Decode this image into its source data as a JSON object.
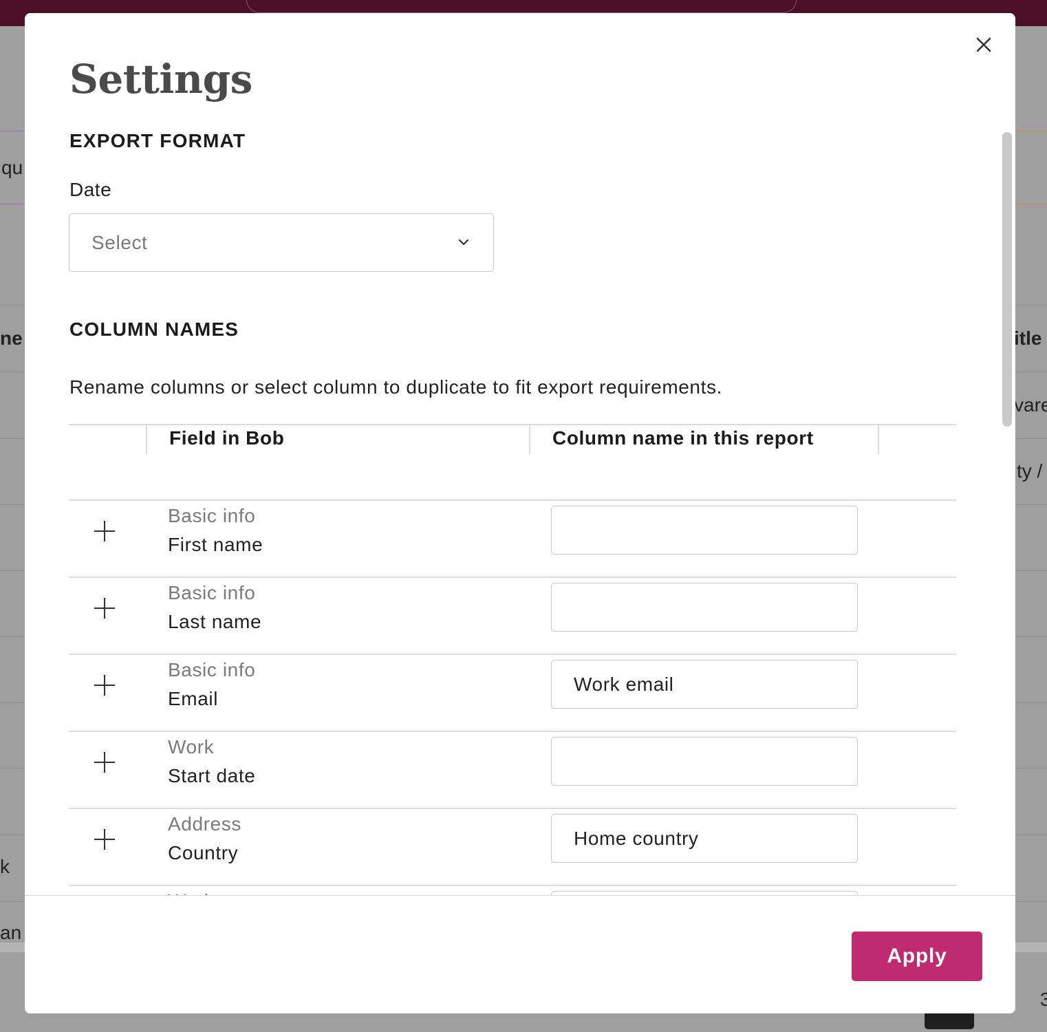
{
  "background": {
    "fragments": [
      "qu",
      "ne",
      "itle",
      "vare",
      "ty /",
      "k",
      "an",
      "3"
    ]
  },
  "modal": {
    "title": "Settings",
    "close_icon": "close-icon",
    "export_format": {
      "heading": "EXPORT FORMAT",
      "date_label": "Date",
      "date_select": {
        "value": "Select",
        "icon": "chevron-down-icon"
      }
    },
    "column_names": {
      "heading": "COLUMN NAMES",
      "description": "Rename columns or select column to duplicate to fit export requirements.",
      "table": {
        "headers": [
          "Field in Bob",
          "Column name in this report"
        ],
        "rows": [
          {
            "category": "Basic info",
            "field": "First name",
            "column_name": ""
          },
          {
            "category": "Basic info",
            "field": "Last name",
            "column_name": ""
          },
          {
            "category": "Basic info",
            "field": "Email",
            "column_name": "Work email"
          },
          {
            "category": "Work",
            "field": "Start date",
            "column_name": ""
          },
          {
            "category": "Address",
            "field": "Country",
            "column_name": "Home country"
          },
          {
            "category": "Work",
            "field": "",
            "column_name": ""
          }
        ],
        "row_action_icon": "plus-icon"
      }
    },
    "footer": {
      "apply_label": "Apply"
    }
  }
}
